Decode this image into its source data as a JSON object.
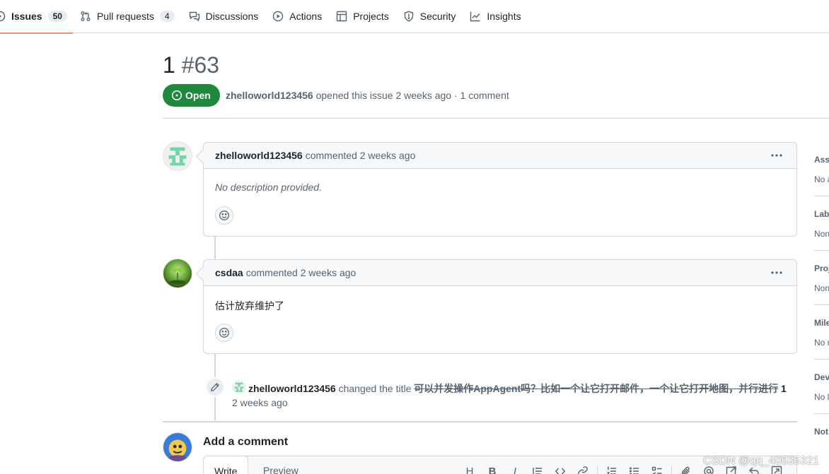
{
  "nav": {
    "items": [
      {
        "label": "Issues",
        "count": "50",
        "icon": "issue-opened-icon"
      },
      {
        "label": "Pull requests",
        "count": "4",
        "icon": "git-pull-request-icon"
      },
      {
        "label": "Discussions",
        "icon": "comment-discussion-icon"
      },
      {
        "label": "Actions",
        "icon": "play-icon"
      },
      {
        "label": "Projects",
        "icon": "table-icon"
      },
      {
        "label": "Security",
        "icon": "shield-icon"
      },
      {
        "label": "Insights",
        "icon": "graph-icon"
      }
    ]
  },
  "issue": {
    "title": "1",
    "number": "#63",
    "state": "Open",
    "author": "zhelloworld123456",
    "meta_rest": "opened this issue 2 weeks ago · 1 comment"
  },
  "comments": [
    {
      "author": "zhelloworld123456",
      "action": "commented 2 weeks ago",
      "body": "No description provided."
    },
    {
      "author": "csdaa",
      "action": "commented 2 weeks ago",
      "body": "估计放弃维护了"
    }
  ],
  "event": {
    "author": "zhelloworld123456",
    "action": "changed the title",
    "old_title": "可以并发操作AppAgent吗？比如一个让它打开邮件，一个让它打开地图，并行进行",
    "new_title": "1",
    "time": "2 weeks ago"
  },
  "new_comment": {
    "heading": "Add a comment",
    "tab_write": "Write",
    "tab_preview": "Preview",
    "heading_tool": "H",
    "bold_tool": "B",
    "italic_tool": "I"
  },
  "sidebar": {
    "sections": [
      {
        "heading": "Assi",
        "value": "No a"
      },
      {
        "heading": "Labe",
        "value": "Non"
      },
      {
        "heading": "Proj",
        "value": "Non"
      },
      {
        "heading": "Mile",
        "value": "No r"
      },
      {
        "heading": "Dev",
        "value": "No l"
      },
      {
        "heading": "Not",
        "value": ""
      }
    ]
  },
  "watermark": "CSDN @qq_40535321",
  "colors": {
    "open_green": "#1f883d",
    "nav_underline": "#fd8c73",
    "border": "#d0d7de",
    "muted_text": "#59636e"
  }
}
